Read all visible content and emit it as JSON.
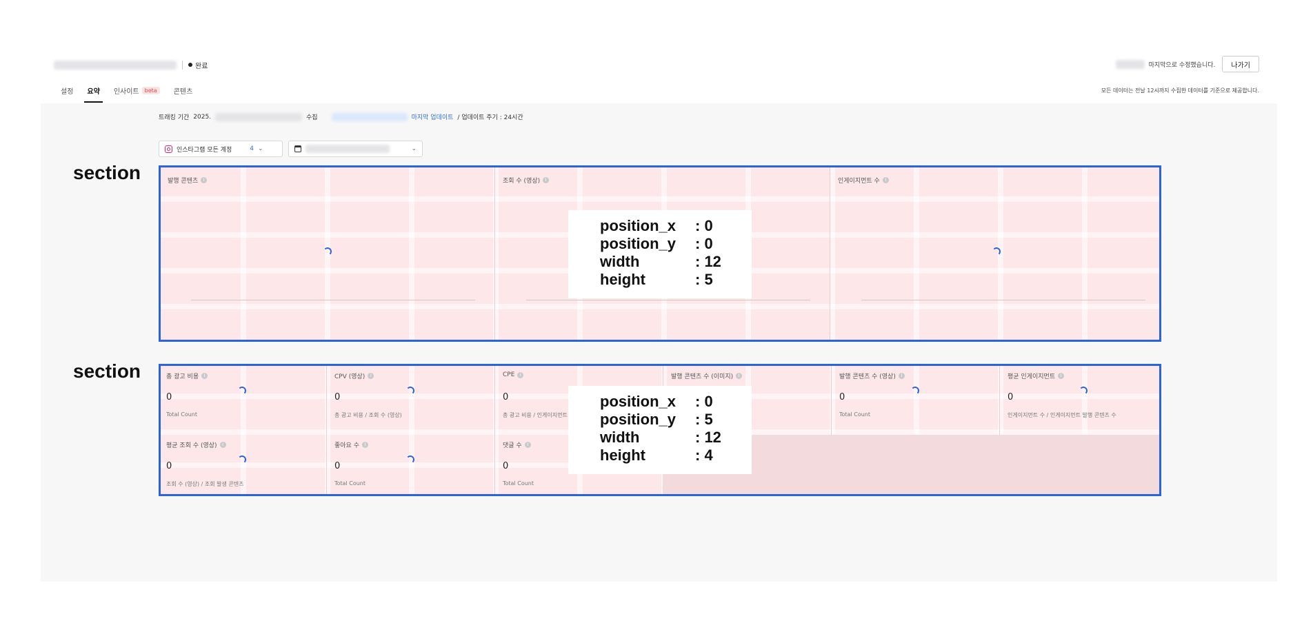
{
  "header": {
    "status_label": "완료",
    "last_modified": "마지막으로 수정했습니다.",
    "exit_button": "나가기",
    "notice": "모든 데이터는 전날 12시까지 수집한 데이터를 기준으로 제공합니다."
  },
  "tabs": [
    {
      "label": "설정"
    },
    {
      "label": "요약"
    },
    {
      "label": "인사이트",
      "badge": "beta"
    },
    {
      "label": "콘텐츠"
    }
  ],
  "tracking": {
    "label": "트래킹 기간",
    "year_prefix": "2025.",
    "collect": "수집",
    "last_update": "마지막 업데이트",
    "cycle": "/ 업데이트 주기 : 24시간"
  },
  "filters": {
    "account_select": "인스타그램 모든 계정",
    "account_count": "4"
  },
  "section_labels": [
    "section",
    "section"
  ],
  "section1": {
    "cards": [
      {
        "title": "발행 콘텐츠"
      },
      {
        "title": "조회 수 (영상)"
      },
      {
        "title": "인게이지먼트 수"
      }
    ],
    "info": {
      "position_x_label": "position_x",
      "position_x": ": 0",
      "position_y_label": "position_y",
      "position_y": ": 0",
      "width_label": "width",
      "width": ": 12",
      "height_label": "height",
      "height": ": 5"
    }
  },
  "section2": {
    "metrics": [
      {
        "title": "총 광고 비용",
        "value": "0",
        "sub": "Total Count"
      },
      {
        "title": "CPV (영상)",
        "value": "0",
        "sub": "총 광고 비용 / 조회 수 (영상)"
      },
      {
        "title": "CPE",
        "value": "0",
        "sub": "총 광고 비용 / 인게이지먼트"
      },
      {
        "title": "발행 콘텐츠 수 (이미지)",
        "value": "",
        "sub": ""
      },
      {
        "title": "발행 콘텐츠 수 (영상)",
        "value": "0",
        "sub": "Total Count"
      },
      {
        "title": "평균 인게이지먼트",
        "value": "0",
        "sub": "인게이지먼트 수 / 인게이지먼트 발행 콘텐츠 수"
      },
      {
        "title": "평균 조회 수 (영상)",
        "value": "0",
        "sub": "조회 수 (영상) / 조회 발생 콘텐츠"
      },
      {
        "title": "좋아요 수",
        "value": "0",
        "sub": "Total Count"
      },
      {
        "title": "댓글 수",
        "value": "0",
        "sub": "Total Count"
      }
    ],
    "info": {
      "position_x_label": "position_x",
      "position_x": ": 0",
      "position_y_label": "position_y",
      "position_y": ": 5",
      "width_label": "width",
      "width": ": 12",
      "height_label": "height",
      "height": ": 4"
    }
  },
  "colors": {
    "section_border": "#2a64dc",
    "section_fill": "#fde7e9",
    "link": "#2f6fe0",
    "beta_badge": "#e14d4d"
  }
}
